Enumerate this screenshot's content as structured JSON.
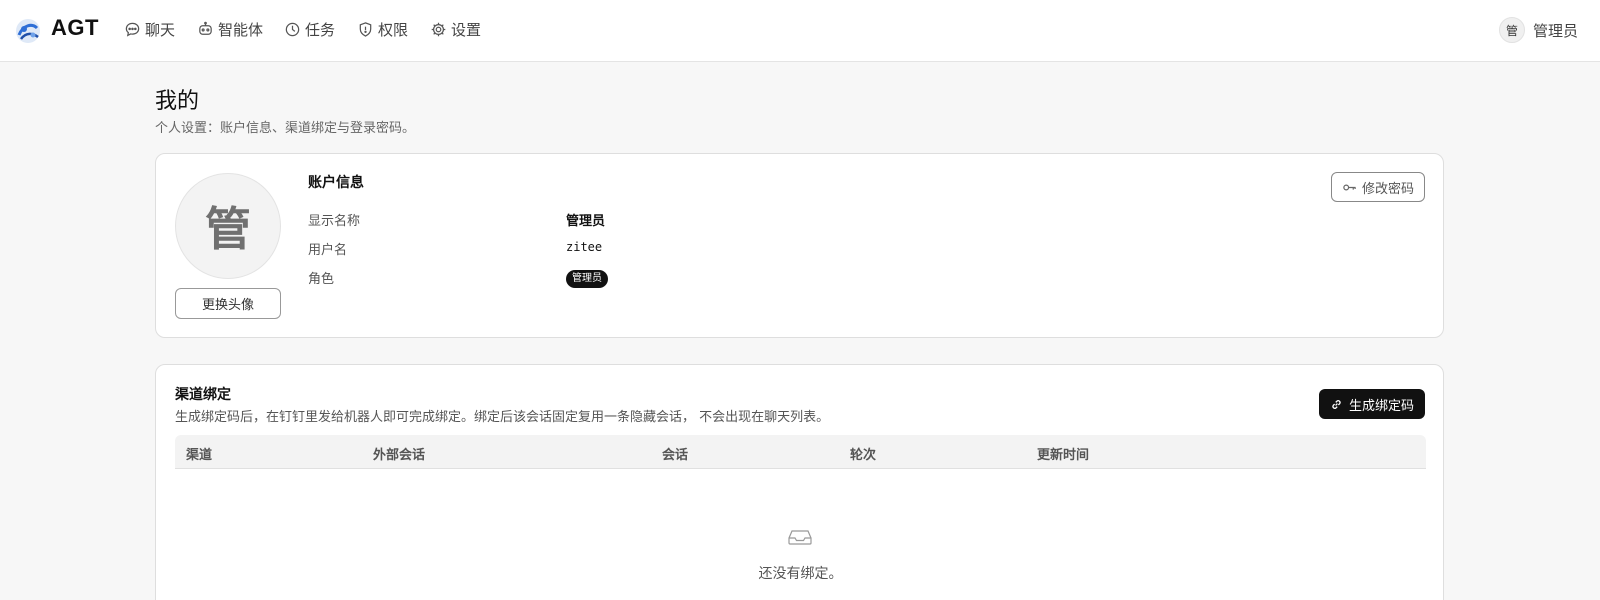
{
  "app": {
    "brand": "AGT"
  },
  "nav": [
    {
      "label": "聊天",
      "icon": "chat-icon"
    },
    {
      "label": "智能体",
      "icon": "robot-icon"
    },
    {
      "label": "任务",
      "icon": "clock-icon"
    },
    {
      "label": "权限",
      "icon": "shield-icon"
    },
    {
      "label": "设置",
      "icon": "gear-icon"
    }
  ],
  "user": {
    "avatar_char": "管",
    "name": "管理员"
  },
  "page": {
    "title": "我的",
    "subtitle": "个人设置：账户信息、渠道绑定与登录密码。"
  },
  "account": {
    "avatar_char": "管",
    "change_avatar_label": "更换头像",
    "title": "账户信息",
    "change_password_label": "修改密码",
    "fields": [
      {
        "label": "显示名称",
        "value": "管理员"
      },
      {
        "label": "用户名",
        "value": "zitee"
      },
      {
        "label": "角色",
        "value": "管理员"
      }
    ]
  },
  "binding": {
    "title": "渠道绑定",
    "description": "生成绑定码后，在钉钉里发给机器人即可完成绑定。绑定后该会话固定复用一条隐藏会话， 不会出现在聊天列表。",
    "generate_label": "生成绑定码",
    "columns": [
      "渠道",
      "外部会话",
      "会话",
      "轮次",
      "更新时间"
    ],
    "empty_text": "还没有绑定。"
  }
}
